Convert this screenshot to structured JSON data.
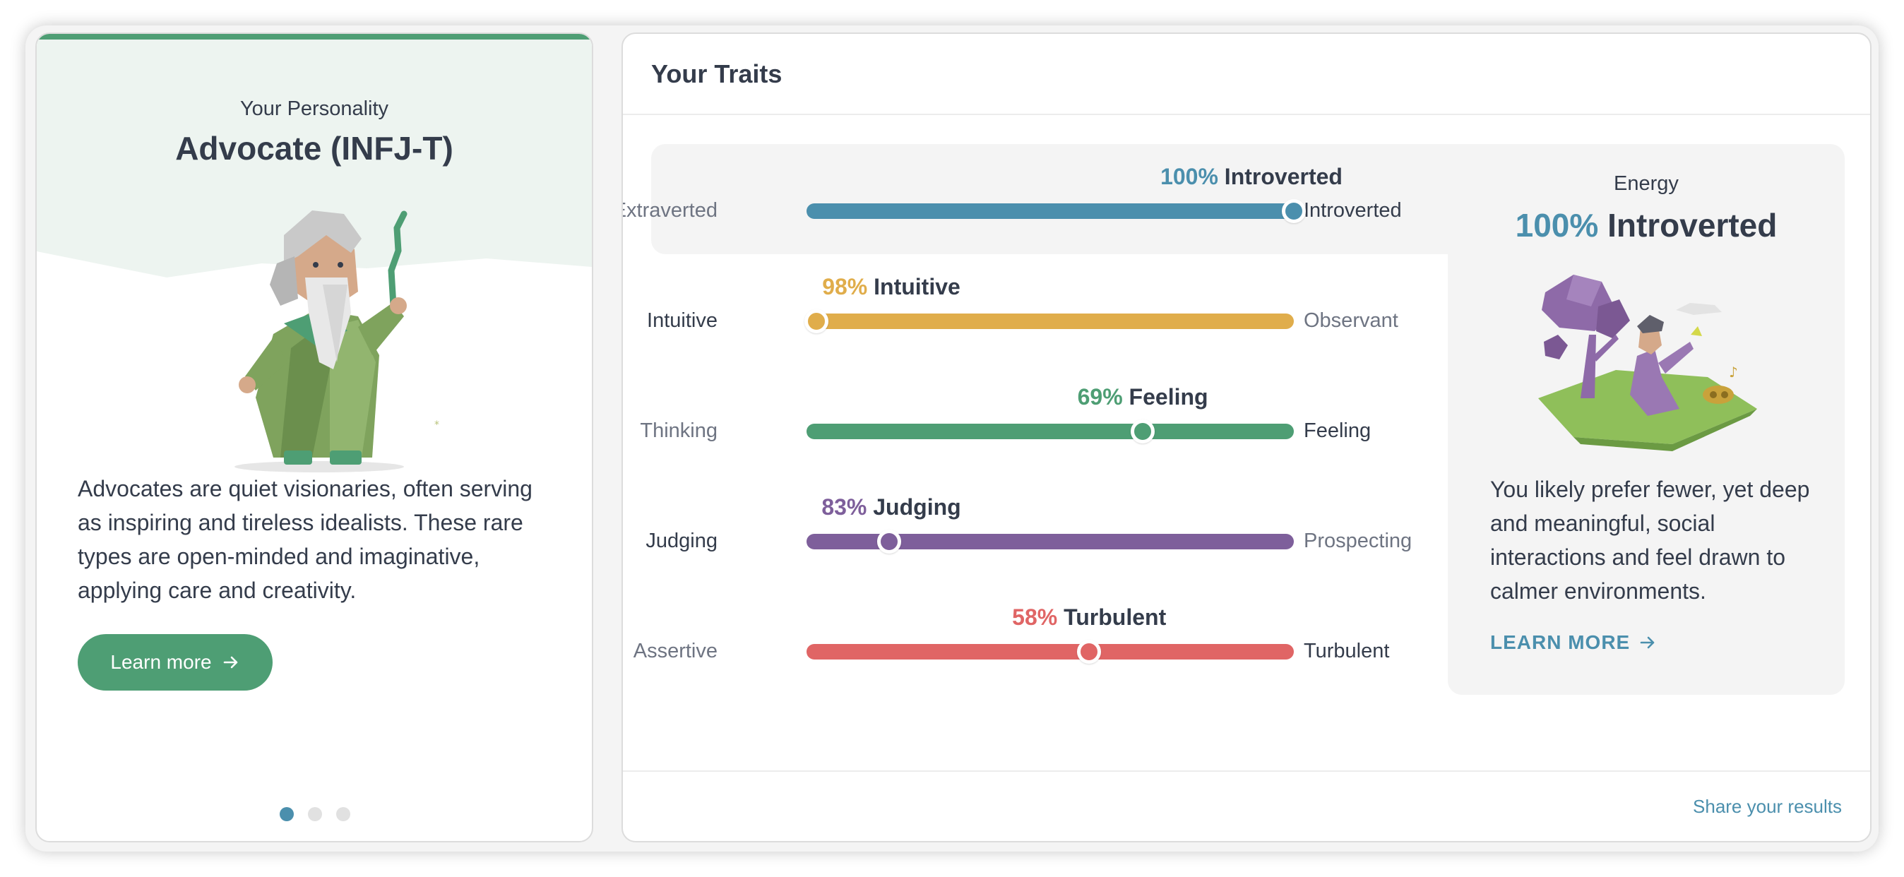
{
  "profile": {
    "eyebrow": "Your Personality",
    "title": "Advocate (INFJ-T)",
    "description": "Advocates are quiet visionaries, often serving as inspiring and tireless idealists. These rare types are open-minded and imaginative, applying care and creativity.",
    "learn_more_label": "Learn more",
    "carousel": {
      "count": 3,
      "active": 1
    },
    "accent_color": "#4e9e74"
  },
  "traits_panel": {
    "title": "Your Traits",
    "share_label": "Share your results",
    "traits": [
      {
        "pct": "100%",
        "label": "Introverted",
        "left": "Extraverted",
        "right": "Introverted",
        "value": 100,
        "side": "right",
        "selected": true,
        "color": "#4b8fad"
      },
      {
        "pct": "98%",
        "label": "Intuitive",
        "left": "Intuitive",
        "right": "Observant",
        "value": 98,
        "side": "left",
        "selected": false,
        "color": "#e0ad4b"
      },
      {
        "pct": "69%",
        "label": "Feeling",
        "left": "Thinking",
        "right": "Feeling",
        "value": 69,
        "side": "right",
        "selected": false,
        "color": "#4e9e74"
      },
      {
        "pct": "83%",
        "label": "Judging",
        "left": "Judging",
        "right": "Prospecting",
        "value": 83,
        "side": "left",
        "selected": false,
        "color": "#7e5f9b"
      },
      {
        "pct": "58%",
        "label": "Turbulent",
        "left": "Assertive",
        "right": "Turbulent",
        "value": 58,
        "side": "right",
        "selected": false,
        "color": "#e06565"
      }
    ]
  },
  "detail": {
    "eyebrow": "Energy",
    "pct": "100%",
    "label": "Introverted",
    "description": "You likely prefer fewer, yet deep and meaningful, social interactions and feel drawn to calmer environments.",
    "link_label": "LEARN MORE"
  }
}
